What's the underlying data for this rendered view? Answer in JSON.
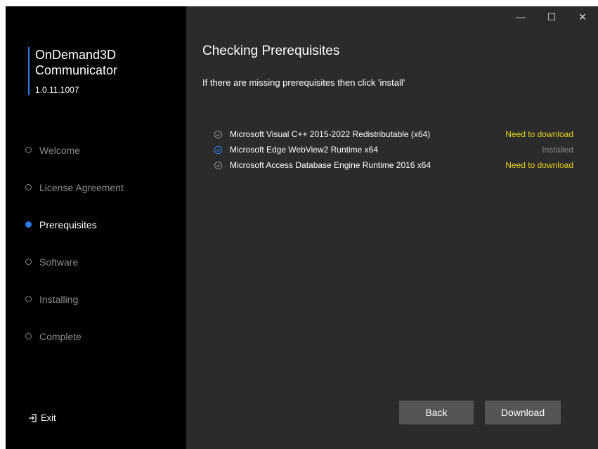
{
  "app": {
    "name": "OnDemand3D\nCommunicator",
    "version": "1.0.11.1007"
  },
  "sidebar": {
    "steps": [
      {
        "label": "Welcome",
        "active": false
      },
      {
        "label": "License Agreement",
        "active": false
      },
      {
        "label": "Prerequisites",
        "active": true
      },
      {
        "label": "Software",
        "active": false
      },
      {
        "label": "Installing",
        "active": false
      },
      {
        "label": "Complete",
        "active": false
      }
    ],
    "exit_label": "Exit"
  },
  "titlebar": {
    "minimize": "—",
    "maximize": "☐",
    "close": "✕"
  },
  "main": {
    "title": "Checking Prerequisites",
    "subtitle": "If there are missing prerequisites then click 'install'",
    "prerequisites": [
      {
        "name": "Microsoft Visual C++ 2015-2022 Redistributable (x64)",
        "status": "Need to download",
        "installed": false
      },
      {
        "name": "Microsoft Edge WebView2 Runtime x64",
        "status": "Installed",
        "installed": true
      },
      {
        "name": "Microsoft Access Database Engine Runtime 2016 x64",
        "status": "Need to download",
        "installed": false
      }
    ]
  },
  "buttons": {
    "back": "Back",
    "download": "Download"
  },
  "colors": {
    "accent": "#2b7be4",
    "need_download": "#e6d21a",
    "installed": "#8a8a8a",
    "sidebar_bg": "#000000",
    "main_bg": "#2b2b2b",
    "button_bg": "#555555"
  }
}
